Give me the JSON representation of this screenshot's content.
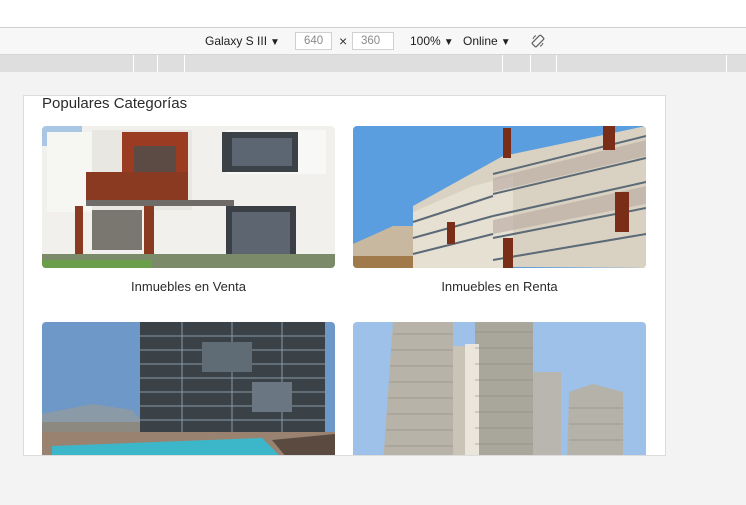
{
  "devtools": {
    "device": "Galaxy S III",
    "width": "640",
    "height": "360",
    "times": "×",
    "zoom": "100%",
    "network": "Online",
    "dropdown_glyph": "▼"
  },
  "page": {
    "section_title": "Populares Categorías",
    "cards": [
      {
        "label": "Inmuebles en Venta",
        "image": "modern house photo"
      },
      {
        "label": "Inmuebles en Renta",
        "image": "apartment building with balconies photo"
      },
      {
        "label": "",
        "image": "glass tower with pool photo"
      },
      {
        "label": "",
        "image": "twin skyscrapers photo"
      }
    ]
  }
}
